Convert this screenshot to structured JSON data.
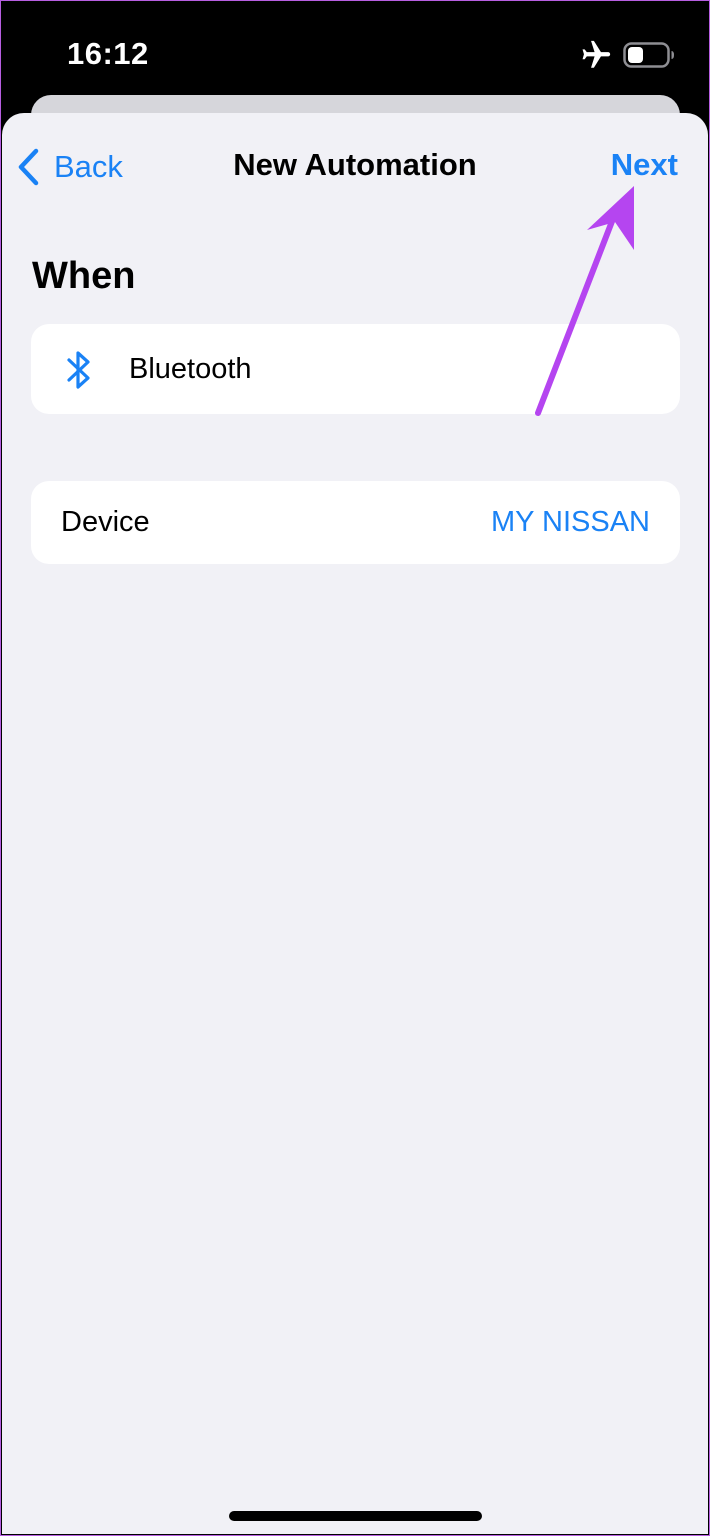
{
  "status_bar": {
    "time": "16:12",
    "icons": [
      "airplane-icon",
      "battery-icon"
    ]
  },
  "nav": {
    "back_label": "Back",
    "title": "New Automation",
    "next_label": "Next"
  },
  "when": {
    "header": "When",
    "trigger_icon": "bluetooth-icon",
    "trigger_label": "Bluetooth"
  },
  "device": {
    "label": "Device",
    "value": "MY NISSAN"
  },
  "colors": {
    "accent": "#1a82f5",
    "background": "#f1f1f6",
    "card": "#ffffff",
    "annotation_arrow": "#b545f0"
  }
}
